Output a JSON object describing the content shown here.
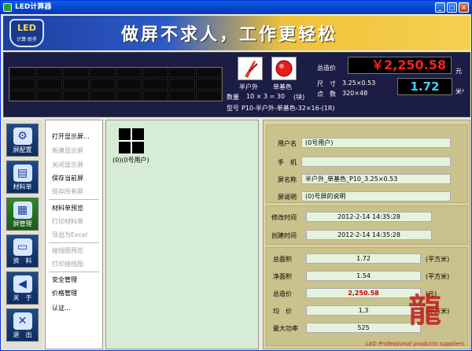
{
  "window": {
    "title": "LED计算器",
    "min": "_",
    "max": "□",
    "close": "×"
  },
  "banner": {
    "logo_top": "LED",
    "logo_bottom": "计算·助手",
    "slogan": "做屏不求人，工作更轻松"
  },
  "info": {
    "mode1": "半户外",
    "mode2": "单基色",
    "count_label": "数量",
    "count_value": "10 × 3 = 30",
    "count_unit": "(块)",
    "model_label": "型号",
    "model_value": "P10-半户外-单基色-32×16-(1R)",
    "total_price_label": "总造价",
    "total_price": "￥2,250.58",
    "price_unit": "元",
    "size_label": "尺　寸",
    "size_value": "3.25×0.53",
    "dots_label": "点　数",
    "dots_value": "320×48",
    "avg_label": "均价",
    "avg_value": "1.72",
    "avg_unit": "米²"
  },
  "nav": [
    {
      "label": "屏配置",
      "icon": "config-icon",
      "glyph": "⚙"
    },
    {
      "label": "材料单",
      "icon": "materials-icon",
      "glyph": "▤"
    },
    {
      "label": "屏管理",
      "icon": "screen-manage-icon",
      "glyph": "▦"
    },
    {
      "label": "资　料",
      "icon": "data-icon",
      "glyph": "▭"
    },
    {
      "label": "关　于",
      "icon": "megaphone-icon",
      "glyph": "◀"
    },
    {
      "label": "退　出",
      "icon": "exit-icon",
      "glyph": "✕"
    }
  ],
  "menu": [
    {
      "label": "打开显示屏...",
      "enabled": true
    },
    {
      "label": "新建显示屏",
      "enabled": false
    },
    {
      "label": "关闭显示屏",
      "enabled": false
    },
    {
      "label": "保存当前屏",
      "enabled": true
    },
    {
      "label": "保存所有屏",
      "enabled": false
    },
    {
      "label": "材料单预览",
      "enabled": true
    },
    {
      "label": "打印材料单",
      "enabled": false
    },
    {
      "label": "导出为Excel",
      "enabled": false
    },
    {
      "label": "接线图预览",
      "enabled": false
    },
    {
      "label": "打印接线图",
      "enabled": false
    },
    {
      "label": "安全管理",
      "enabled": true
    },
    {
      "label": "价格管理",
      "enabled": true
    },
    {
      "label": "认证...",
      "enabled": true
    }
  ],
  "canvas": {
    "screen_label": "(0)(0号用户)"
  },
  "props": {
    "user_label": "用户名",
    "user_value": "(0号用户)",
    "phone_label": "手　机",
    "phone_value": "",
    "name_label": "屏名称",
    "name_value": "半户外_单基色_P10_3.25×0.53",
    "desc_label": "屏说明",
    "desc_value": "(0)号屏的说明",
    "mod_label": "修改时间",
    "mod_value": "2012-2-14 14:35:28",
    "create_label": "创建时间",
    "create_value": "2012-2-14 14:35:28",
    "area_label": "总面积",
    "area_value": "1.72",
    "area_unit": "(平方米)",
    "net_label": "净面积",
    "net_value": "1.54",
    "net_unit": "(平方米)",
    "cost_label": "总造价",
    "cost_value": "2,250.58",
    "cost_unit": "(元)",
    "avg_label": "均　价",
    "avg_value": "1,3",
    "avg_unit": "(平方米)",
    "power_label": "最大功率",
    "power_value": "525"
  },
  "watermark": "LED Professional products suppliers"
}
